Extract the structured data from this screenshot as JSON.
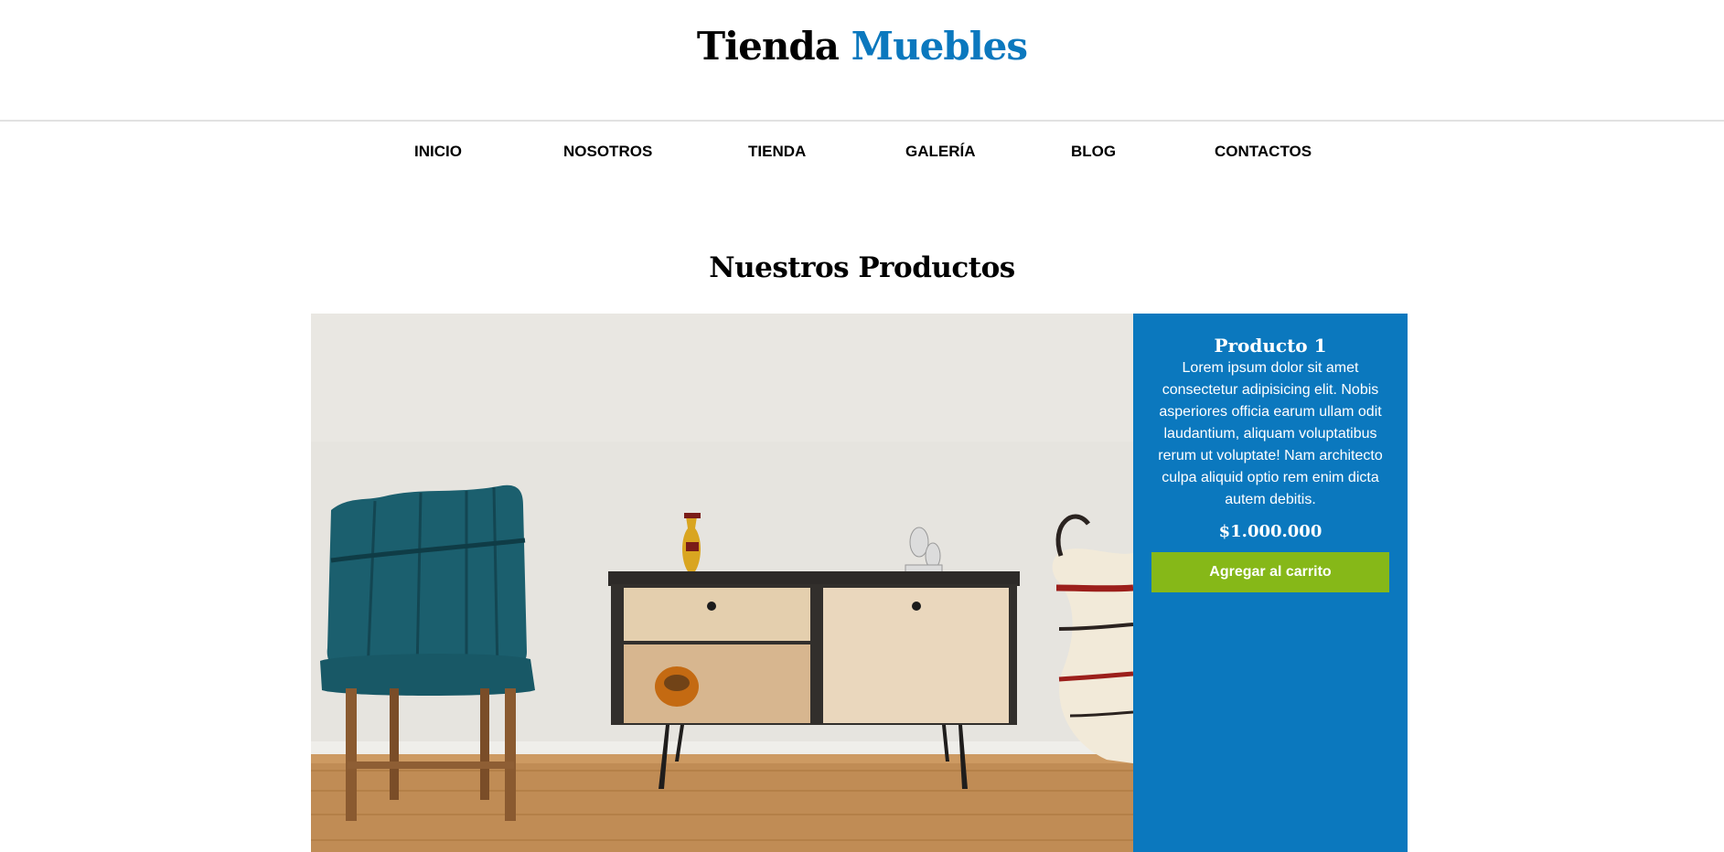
{
  "header": {
    "brand_main": "Tienda",
    "brand_accent": "Muebles"
  },
  "nav": {
    "items": [
      "INICIO",
      "NOSOTROS",
      "TIENDA",
      "GALERÍA",
      "BLOG",
      "CONTACTOS"
    ]
  },
  "products_section": {
    "title": "Nuestros Productos"
  },
  "product": {
    "name": "Producto 1",
    "description": "Lorem ipsum dolor sit amet consectetur adipisicing elit. Nobis asperiores officia earum ullam odit laudantium, aliquam voluptatibus rerum ut voluptate! Nam architecto culpa aliquid optio rem enim dicta autem debitis.",
    "price": "$1.000.000",
    "button_label": "Agregar al carrito"
  },
  "colors": {
    "accent_blue": "#0b78be",
    "button_green": "#86b818"
  }
}
